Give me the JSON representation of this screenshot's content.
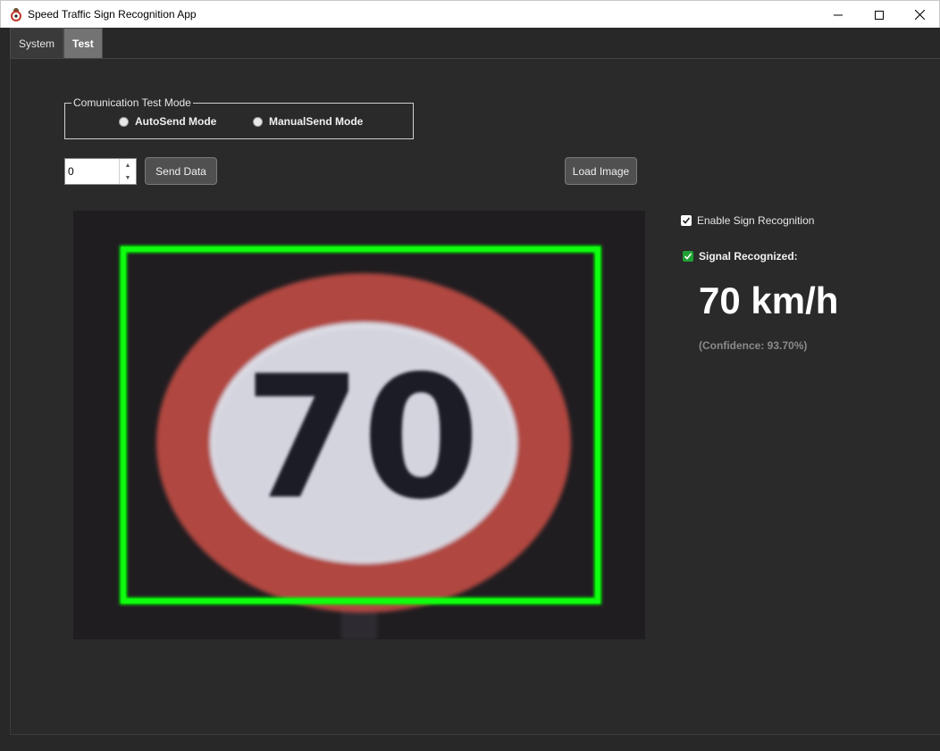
{
  "window": {
    "title": "Speed Traffic Sign Recognition App",
    "icon": "app-icon"
  },
  "tabs": [
    {
      "label": "System",
      "active": false
    },
    {
      "label": "Test",
      "active": true
    }
  ],
  "comm_mode": {
    "legend": "Comunication Test Mode",
    "options": [
      {
        "label": "AutoSend Mode"
      },
      {
        "label": "ManualSend Mode"
      }
    ]
  },
  "controls": {
    "spinner_value": "0",
    "send_label": "Send Data",
    "load_label": "Load Image"
  },
  "viewer": {
    "sign_text": "70",
    "box_color": "#00ff00"
  },
  "recognition": {
    "enable_label": "Enable Sign Recognition",
    "enable_checked": true,
    "recognized_label": "Signal Recognized:",
    "recognized_checked": true,
    "speed_text": "70 km/h",
    "confidence_text": "(Confidence: 93.70%)"
  },
  "colors": {
    "accent_green": "#1fa033",
    "bounding_box": "#00ff00",
    "sign_red": "#b8463f"
  }
}
